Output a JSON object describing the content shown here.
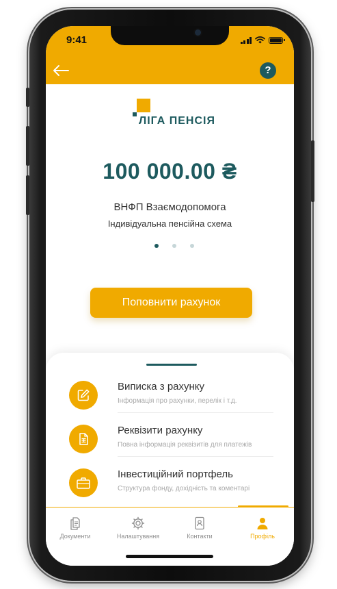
{
  "status_bar": {
    "time": "9:41"
  },
  "header": {
    "back_icon": "arrow-left-icon",
    "help_label": "?"
  },
  "logo": {
    "text": "ЛІГА ПЕНСІЯ"
  },
  "account": {
    "amount": "100 000.00 ₴",
    "fund_name": "ВНФП Взаємодопомога",
    "scheme": "Індивідуальна пенсійна схема",
    "carousel": {
      "total": 3,
      "active": 1
    }
  },
  "actions": {
    "topup_label": "Поповнити рахунок"
  },
  "menu": {
    "items": [
      {
        "title": "Виписка з рахунку",
        "subtitle": "Інформація про рахунки, перелік і т.д.",
        "icon": "edit-pencil-icon"
      },
      {
        "title": "Реквізити рахунку",
        "subtitle": "Повна інформація реквізитів для платежів",
        "icon": "document-list-icon"
      },
      {
        "title": "Інвестиційний портфель",
        "subtitle": "Структура фонду, дохідність та коментарі",
        "icon": "briefcase-icon"
      }
    ]
  },
  "tabbar": {
    "tabs": [
      {
        "label": "Документи",
        "icon": "documents-icon",
        "active": false
      },
      {
        "label": "Налаштування",
        "icon": "settings-gear-icon",
        "active": false
      },
      {
        "label": "Контакти",
        "icon": "contacts-icon",
        "active": false
      },
      {
        "label": "Профіль",
        "icon": "profile-icon",
        "active": true
      }
    ]
  },
  "colors": {
    "accent": "#f0aa00",
    "brand": "#1d5a5e",
    "inactive": "#8d8d8d",
    "muted_text": "#a8a8a8"
  }
}
